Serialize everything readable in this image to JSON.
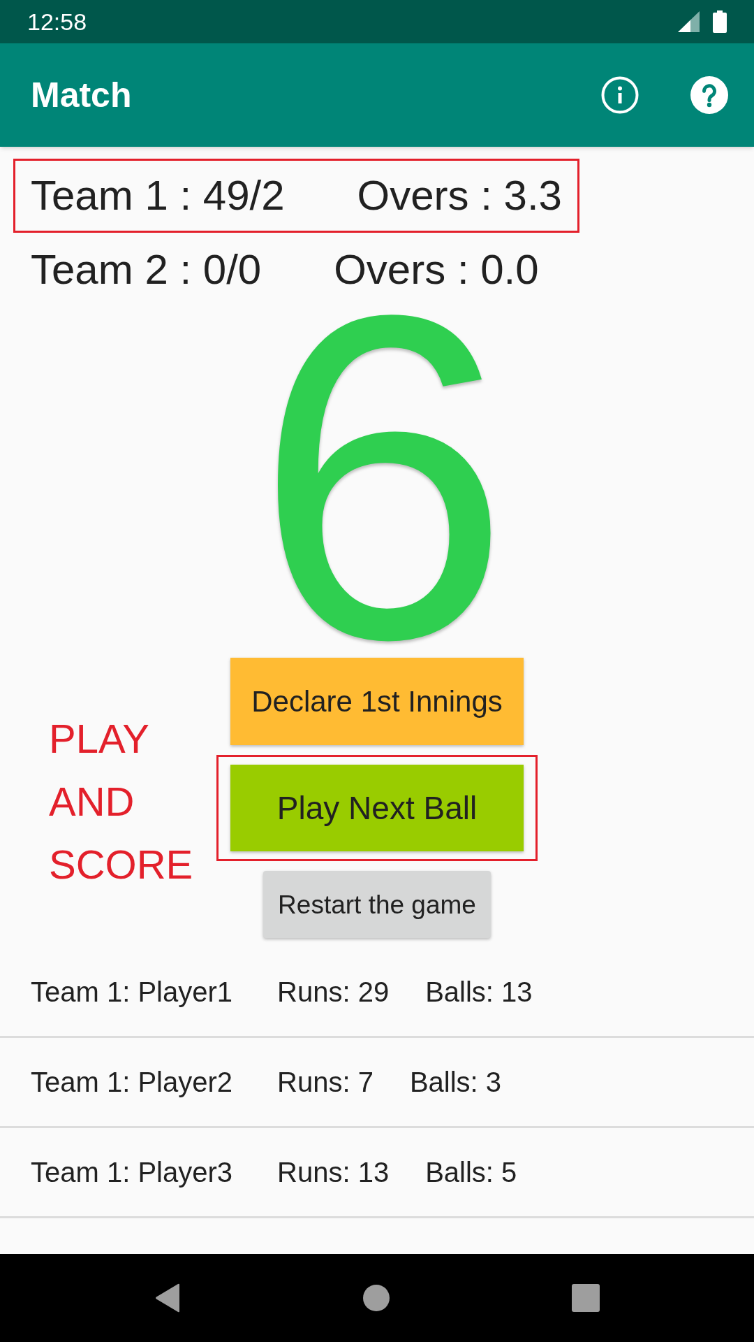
{
  "status_bar": {
    "time": "12:58"
  },
  "app_bar": {
    "title": "Match"
  },
  "scores": [
    {
      "team": "Team 1 : 49/2",
      "overs": "Overs : 3.3",
      "highlighted": true
    },
    {
      "team": "Team 2 : 0/0",
      "overs": "Overs : 0.0",
      "highlighted": false
    }
  ],
  "last_ball": {
    "runs": "6"
  },
  "buttons": [
    {
      "kind": "declare",
      "label": "Declare 1st Innings",
      "color": "#ffbb33",
      "highlighted": false
    },
    {
      "kind": "play",
      "label": "Play Next Ball",
      "color": "#99cc00",
      "highlighted": true
    },
    {
      "kind": "restart",
      "label": "Restart the game",
      "color": "#d6d7d7",
      "highlighted": false
    }
  ],
  "annotation": {
    "text": "PLAY AND SCORE"
  },
  "players": [
    {
      "player": "Team 1: Player1",
      "runs": "Runs: 29",
      "balls": "Balls: 13"
    },
    {
      "player": "Team 1: Player2",
      "runs": "Runs: 7",
      "balls": "Balls: 3"
    },
    {
      "player": "Team 1: Player3",
      "runs": "Runs: 13",
      "balls": "Balls: 5"
    }
  ]
}
